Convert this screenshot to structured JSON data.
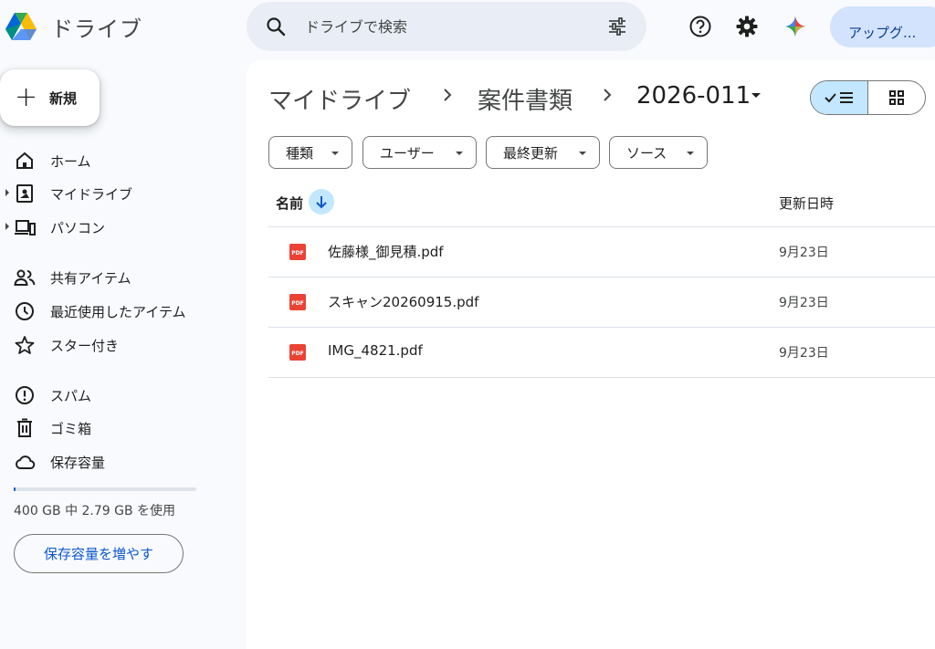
{
  "app": {
    "title": "ドライブ"
  },
  "search": {
    "placeholder": "ドライブで検索"
  },
  "header": {
    "upgrade_label": "アップグ..."
  },
  "sidebar": {
    "new_label": "新規",
    "items": [
      {
        "label": "ホーム",
        "icon": "home-icon"
      },
      {
        "label": "マイドライブ",
        "icon": "my-drive-icon"
      },
      {
        "label": "パソコン",
        "icon": "computers-icon"
      },
      {
        "label": "共有アイテム",
        "icon": "shared-icon"
      },
      {
        "label": "最近使用したアイテム",
        "icon": "clock-icon"
      },
      {
        "label": "スター付き",
        "icon": "star-icon"
      },
      {
        "label": "スパム",
        "icon": "spam-icon"
      },
      {
        "label": "ゴミ箱",
        "icon": "trash-icon"
      },
      {
        "label": "保存容量",
        "icon": "cloud-icon"
      }
    ],
    "storage": {
      "text": "400 GB 中 2.79 GB を使用",
      "used_fraction": 0.007,
      "button": "保存容量を増やす"
    }
  },
  "breadcrumb": {
    "items": [
      "マイドライブ",
      "案件書類",
      "2026-011"
    ]
  },
  "filters": [
    "種類",
    "ユーザー",
    "最終更新",
    "ソース"
  ],
  "table": {
    "headers": {
      "name": "名前",
      "modified": "更新日時"
    },
    "rows": [
      {
        "name": "佐藤様_御見積.pdf",
        "modified": "9月23日"
      },
      {
        "name": "スキャン20260915.pdf",
        "modified": "9月23日"
      },
      {
        "name": "IMG_4821.pdf",
        "modified": "9月23日"
      }
    ]
  },
  "colors": {
    "accent": "#0b57d0",
    "selected": "#c2e7ff",
    "pdf": "#ea4335"
  }
}
